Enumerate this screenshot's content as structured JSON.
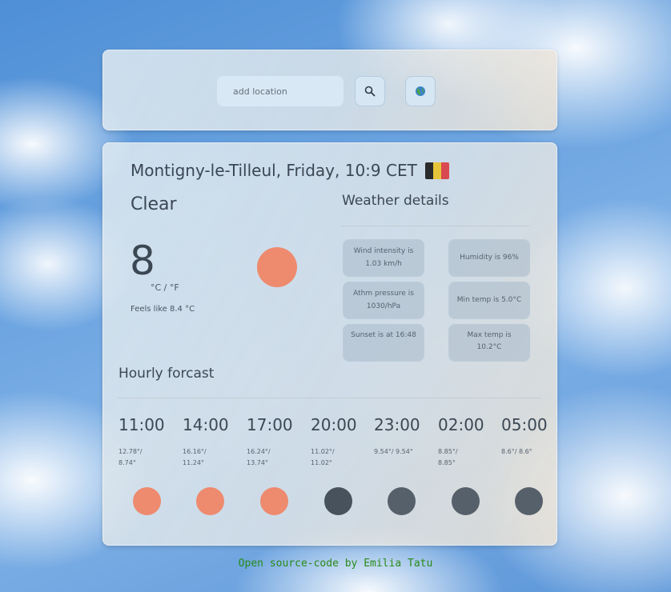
{
  "search": {
    "placeholder": "add location"
  },
  "location": {
    "line": "Montigny-le-Tilleul, Friday, 10:9 CET",
    "flag_colors": [
      "#2b2b2b",
      "#e6c53a",
      "#d84a4f"
    ]
  },
  "current": {
    "condition": "Clear",
    "temperature": "8",
    "units": "°C / °F",
    "feels_like": "Feels like 8.4 °C",
    "icon_color": "#ee8a6e"
  },
  "details": {
    "title": "Weather details",
    "items": [
      {
        "text": "Wind intensity is 1.03 km/h"
      },
      {
        "text": "Humidity is 96%"
      },
      {
        "text": "Athm pressure is 1030/hPa"
      },
      {
        "text": "Min temp is 5.0°C"
      },
      {
        "text": "Sunset is at 16:48"
      },
      {
        "text": "Max temp is 10.2°C"
      }
    ]
  },
  "hourly": {
    "title": "Hourly forcast",
    "items": [
      {
        "time": "11:00",
        "temp": "12.78°/ 8.74°",
        "color": "#ee8a6e"
      },
      {
        "time": "14:00",
        "temp": "16.16°/ 11.24°",
        "color": "#ee8a6e"
      },
      {
        "time": "17:00",
        "temp": "16.24°/ 13.74°",
        "color": "#ee8a6e"
      },
      {
        "time": "20:00",
        "temp": "11.02°/ 11.02°",
        "color": "#47525c"
      },
      {
        "time": "23:00",
        "temp": "9.54°/ 9.54°",
        "color": "#56606a"
      },
      {
        "time": "02:00",
        "temp": "8.85°/ 8.85°",
        "color": "#56606a"
      },
      {
        "time": "05:00",
        "temp": "8.6°/ 8.6°",
        "color": "#56606a"
      }
    ]
  },
  "footer": {
    "text": "Open source-code by Emilia Tatu"
  }
}
